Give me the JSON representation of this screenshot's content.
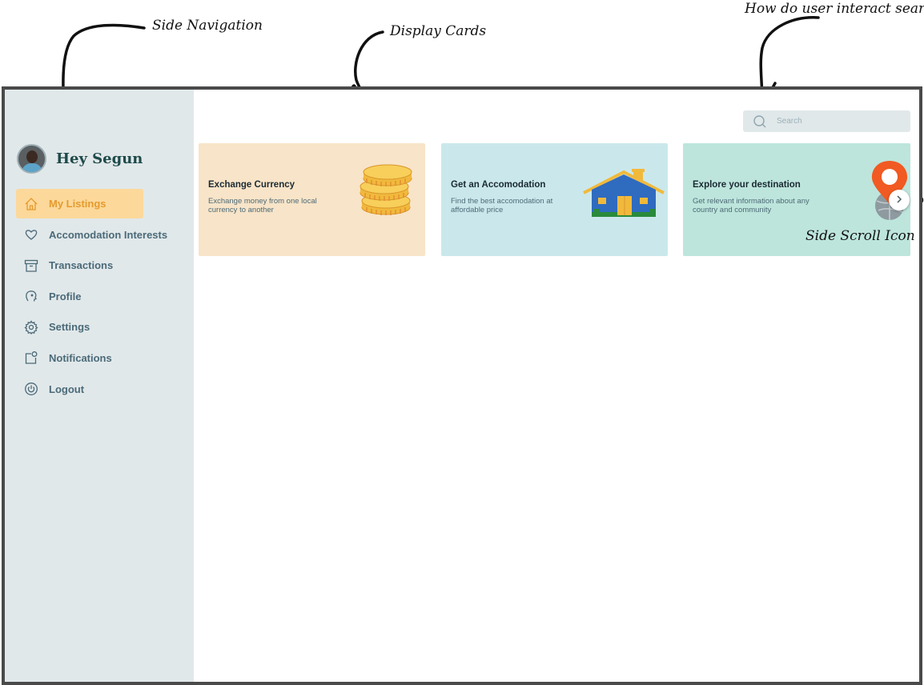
{
  "annotations": {
    "side_navigation": "Side Navigation",
    "display_cards": "Display Cards",
    "search": "How do user interact search",
    "side_scroll": "Side Scroll Icon"
  },
  "user": {
    "greeting": "Hey Segun"
  },
  "sidebar": {
    "items": [
      {
        "label": "My Listings",
        "icon": "home-icon",
        "active": true
      },
      {
        "label": "Accomodation Interests",
        "icon": "heart-icon",
        "active": false
      },
      {
        "label": "Transactions",
        "icon": "archive-icon",
        "active": false
      },
      {
        "label": "Profile",
        "icon": "profile-head-icon",
        "active": false
      },
      {
        "label": "Settings",
        "icon": "gear-icon",
        "active": false
      },
      {
        "label": "Notifications",
        "icon": "notification-icon",
        "active": false
      },
      {
        "label": "Logout",
        "icon": "power-icon",
        "active": false
      }
    ]
  },
  "search": {
    "placeholder": "Search"
  },
  "cards": [
    {
      "title": "Exchange Currency",
      "description": "Exchange money from one local currency to another",
      "art": "coins-icon",
      "color": "#f8e4c8"
    },
    {
      "title": "Get an Accomodation",
      "description": "Find the best accomodation at affordable price",
      "art": "house-icon",
      "color": "#cae8ec"
    },
    {
      "title": "Explore your destination",
      "description": "Get relevant information about any country and community",
      "art": "map-pin-globe-icon",
      "color": "#bde5dc"
    }
  ],
  "colors": {
    "sidebar_bg": "#e1e8ea",
    "active_bg": "#fcd89a",
    "active_text": "#e49b2e",
    "nav_text": "#4b6a78",
    "frame_border": "#4a4a4a"
  }
}
